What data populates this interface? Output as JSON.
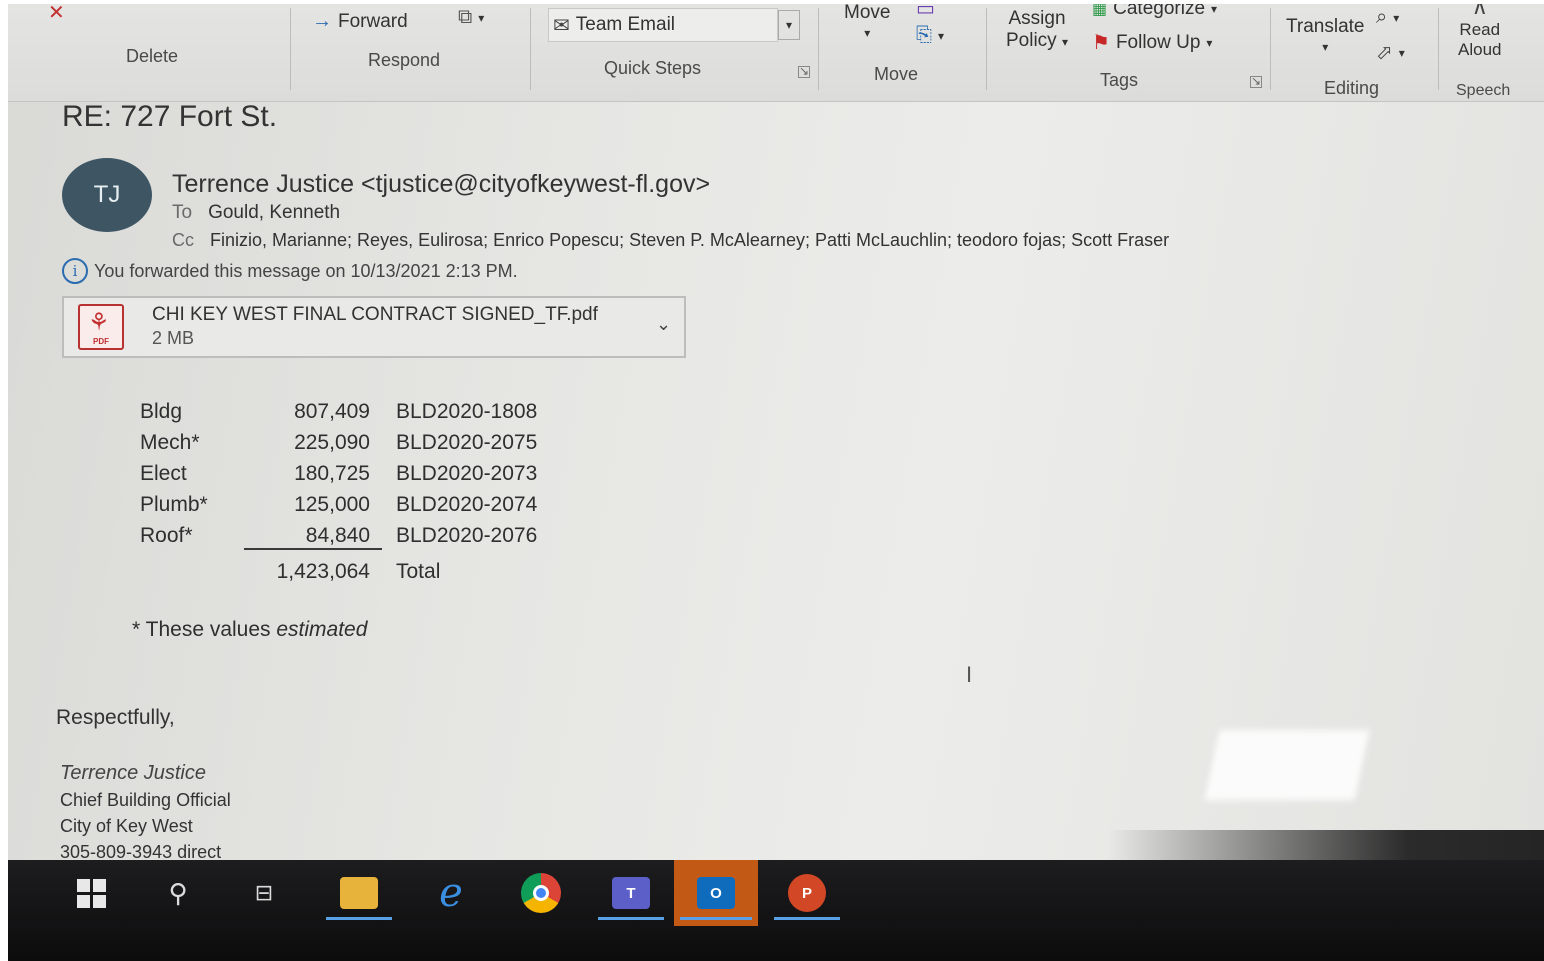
{
  "ribbon": {
    "delete_group": "Delete",
    "respond_group": "Respond",
    "forward_label": "Forward",
    "quick_steps_group": "Quick Steps",
    "team_email_label": "Team Email",
    "move_group": "Move",
    "move_label": "Move",
    "assign_policy_line1": "Assign",
    "assign_policy_line2": "Policy",
    "categorize_label": "Categorize",
    "follow_up_label": "Follow Up",
    "tags_group": "Tags",
    "translate_label": "Translate",
    "editing_group": "Editing",
    "read_aloud_line1": "Read",
    "read_aloud_line2": "Aloud",
    "speech_group": "Speech"
  },
  "message": {
    "subject": "RE: 727 Fort St.",
    "avatar_initials": "TJ",
    "sender": "Terrence Justice <tjustice@cityofkeywest-fl.gov>",
    "to_label": "To",
    "to_value": "Gould, Kenneth",
    "cc_label": "Cc",
    "cc_value": "Finizio, Marianne; Reyes, Eulirosa; Enrico Popescu; Steven P. McAlearney; Patti McLauchlin; teodoro fojas; Scott Fraser",
    "info_text": "You forwarded this message on 10/13/2021 2:13 PM.",
    "attachment": {
      "name": "CHI KEY WEST FINAL CONTRACT SIGNED_TF.pdf",
      "size": "2 MB",
      "icon_tag": "PDF"
    }
  },
  "permits": {
    "rows": [
      {
        "trade": "Bldg",
        "amount": "807,409",
        "permit": "BLD2020-1808"
      },
      {
        "trade": "Mech*",
        "amount": "225,090",
        "permit": "BLD2020-2075"
      },
      {
        "trade": "Elect",
        "amount": "180,725",
        "permit": "BLD2020-2073"
      },
      {
        "trade": "Plumb*",
        "amount": "125,000",
        "permit": "BLD2020-2074"
      },
      {
        "trade": "Roof*",
        "amount": "84,840",
        "permit": "BLD2020-2076"
      }
    ],
    "total_amount": "1,423,064",
    "total_label": "Total",
    "footnote_prefix": "* These values ",
    "footnote_emph": "estimated"
  },
  "signature": {
    "closing": "Respectfully,",
    "name": "Terrence Justice",
    "title": "Chief Building Official",
    "org": "City of Key West",
    "phone": "305-809-3943 direct"
  },
  "colors": {
    "accent": "#2b6cb0",
    "avatar_bg": "#3e5663",
    "pdf_red": "#c23030",
    "outlook_active": "#c25a16",
    "taskbar_bg": "#111111"
  }
}
